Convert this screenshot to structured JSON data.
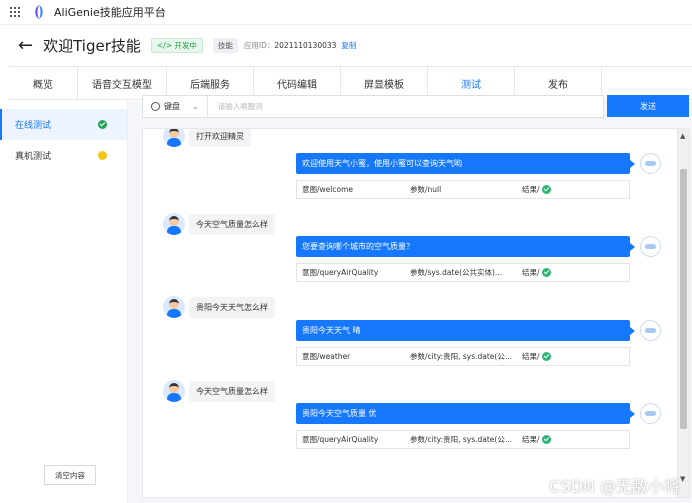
{
  "app": {
    "name": "AliGenie技能应用平台"
  },
  "header": {
    "title": "欢迎Tiger技能",
    "status_badge": "</> 开发中",
    "type_badge": "技能",
    "appid_label": "应用ID：",
    "appid_value": "2021110130033",
    "copy_label": "复制"
  },
  "tabs": [
    {
      "label": "概览"
    },
    {
      "label": "语音交互模型"
    },
    {
      "label": "后端服务"
    },
    {
      "label": "代码编辑"
    },
    {
      "label": "屏显模板"
    },
    {
      "label": "测试"
    },
    {
      "label": "发布"
    }
  ],
  "active_tab": "测试",
  "sidebar": {
    "items": [
      {
        "label": "在线测试",
        "status": "green"
      },
      {
        "label": "真机测试",
        "status": "yellow"
      }
    ]
  },
  "input": {
    "mode": "键盘",
    "placeholder": "请输入唤醒词",
    "send_label": "发送"
  },
  "chat": {
    "partial_top_user": "打开欢迎精灵",
    "messages": [
      {
        "bot_text": "欢迎使用天气小蜜，使用小蜜可以查询天气哟",
        "intent": "意图/welcome",
        "params": "参数/null",
        "result": "结果/"
      },
      {
        "user_text": "今天空气质量怎么样",
        "bot_text": "您要查询哪个城市的空气质量？",
        "intent": "意图/queryAirQuality",
        "params": "参数/sys.date(公共实体)...",
        "result": "结果/"
      },
      {
        "user_text": "贵阳今天天气怎么样",
        "bot_text": "贵阳今天天气 晴",
        "intent": "意图/weather",
        "params": "参数/city:贵阳, sys.date(公...",
        "result": "结果/"
      },
      {
        "user_text": "今天空气质量怎么样",
        "bot_text": "贵阳今天空气质量 优",
        "intent": "意图/queryAirQuality",
        "params": "参数/city:贵阳, sys.date(公...",
        "result": "结果/"
      }
    ],
    "clear_label": "清空内容"
  },
  "watermark": "CSDN @无敌小将"
}
